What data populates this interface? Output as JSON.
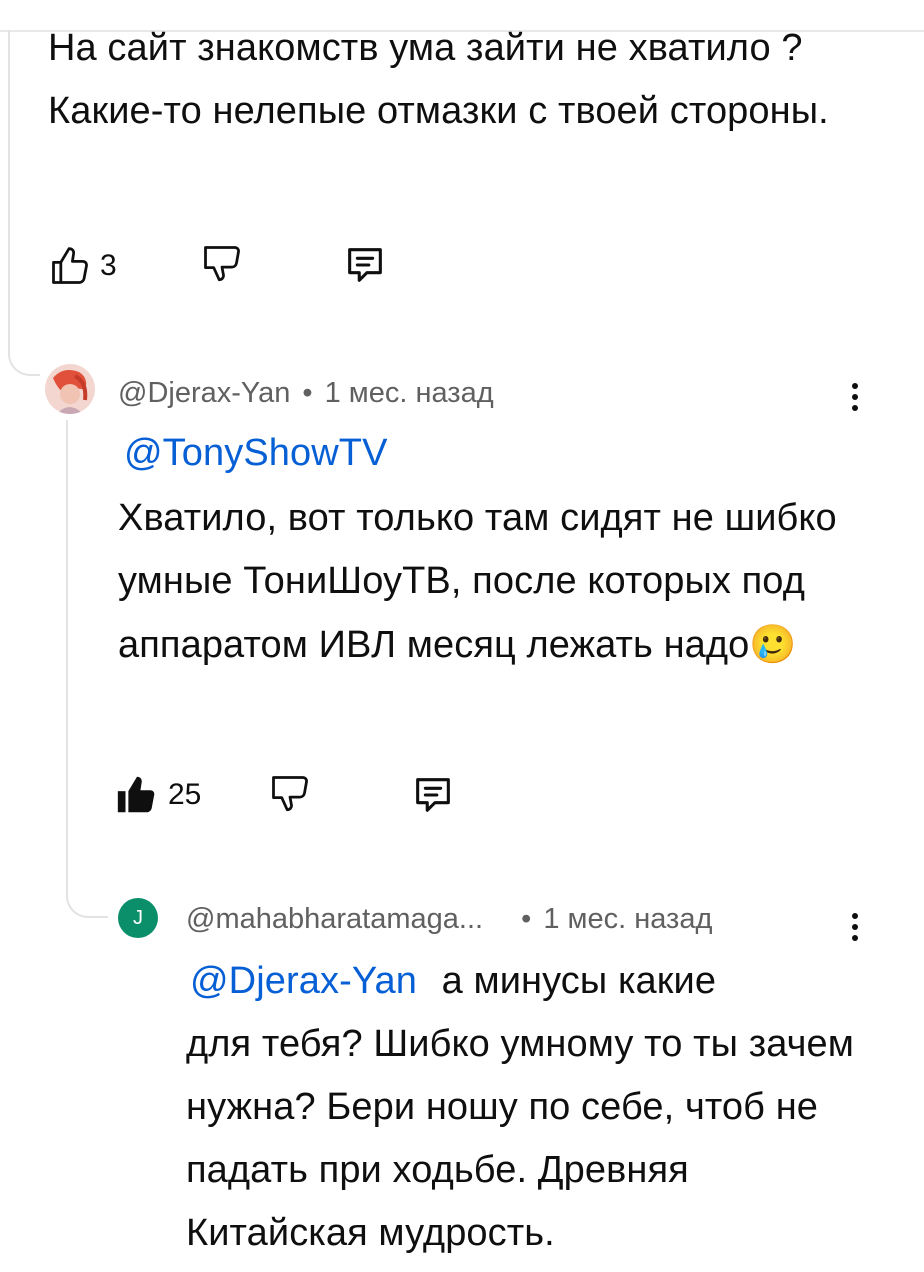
{
  "comment_1": {
    "text": "На сайт знакомств ума зайти не хватило ? Какие-то нелепые отмазки с твоей стороны.",
    "like_count": "3",
    "like_icon": "thumb-up-outline-icon",
    "dislike_icon": "thumb-down-outline-icon",
    "reply_icon": "reply-icon"
  },
  "comment_2": {
    "author": "@Djerax-Yan",
    "separator": "•",
    "time": "1 мес. назад",
    "mention": "@TonyShowTV",
    "text": "Хватило, вот только там сидят не шибко умные ТониШоуТВ, после которых под аппаратом ИВЛ месяц лежать надо",
    "emoji": "🥲",
    "like_count": "25",
    "like_icon": "thumb-up-filled-icon",
    "dislike_icon": "thumb-down-outline-icon",
    "reply_icon": "reply-icon",
    "more_icon": "more-vertical-icon"
  },
  "comment_3": {
    "avatar_letter": "J",
    "author": "@mahabharatamaga...",
    "separator": "•",
    "time": "1 мес. назад",
    "mention": "@Djerax-Yan",
    "text_line1": "а минусы какие",
    "text_rest": "для тебя? Шибко умному то ты зачем нужна? Бери ношу по себе, чтоб не падать при ходьбе. Древняя Китайская мудрость.",
    "more_icon": "more-vertical-icon"
  },
  "colors": {
    "mention": "#065fd4",
    "meta": "#606060",
    "avatar_bg": "#0b8f6a",
    "thread_line": "#e3e3e3"
  }
}
